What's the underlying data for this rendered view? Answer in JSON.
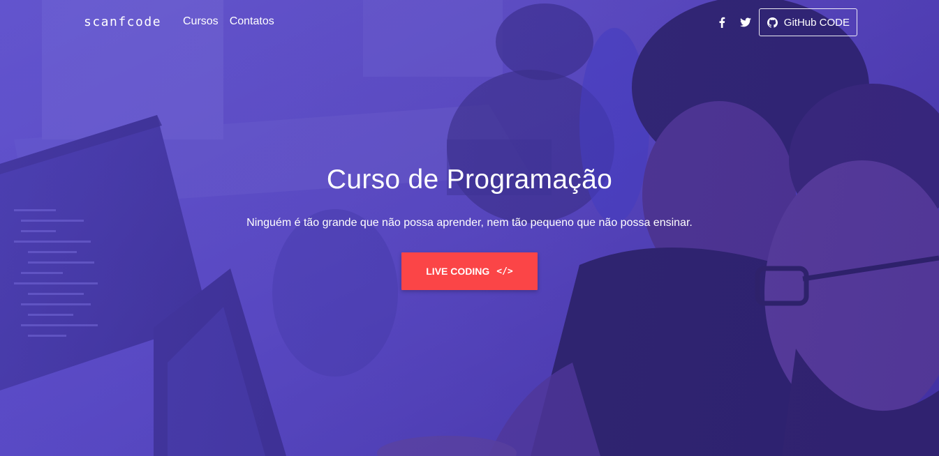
{
  "navbar": {
    "brand": "scanfcode",
    "links": [
      {
        "label": "Cursos"
      },
      {
        "label": "Contatos"
      }
    ],
    "social": [
      {
        "icon": "facebook-icon"
      },
      {
        "icon": "twitter-icon"
      }
    ],
    "github_button": {
      "icon": "github-icon",
      "label": "GitHub CODE"
    }
  },
  "hero": {
    "title": "Curso de Programação",
    "subtitle": "Ninguém é tão grande que não possa aprender, nem tão pequeno que não possa ensinar.",
    "cta": {
      "label": "LIVE CODING",
      "icon": "code-icon",
      "icon_glyph": "</>"
    }
  },
  "colors": {
    "overlay": "#5c4ed2",
    "cta_background": "#fb4547",
    "text": "#ffffff"
  }
}
